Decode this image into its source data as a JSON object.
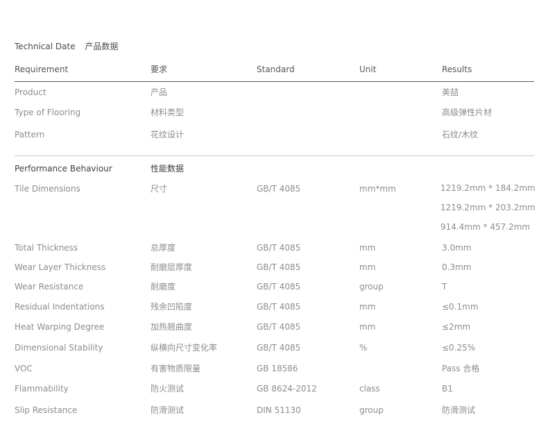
{
  "title": {
    "en": "Technical Date",
    "zh": "产品数据"
  },
  "header": {
    "requirement": "Requirement",
    "requirement_zh": "要求",
    "standard": "Standard",
    "unit": "Unit",
    "results": "Results"
  },
  "product_rows": [
    {
      "en": "Product",
      "zh": "产品",
      "result": "美喆"
    },
    {
      "en": "Type of Flooring",
      "zh": "材料类型",
      "result": "高级弹性片材"
    },
    {
      "en": "Pattern",
      "zh": "花纹设计",
      "result": "石纹/木纹"
    }
  ],
  "performance": {
    "section_en": "Performance Behaviour",
    "section_zh": "性能数据",
    "tile_dimensions": {
      "en": "Tile Dimensions",
      "zh": "尺寸",
      "standard": "GB/T 4085",
      "unit": "mm*mm",
      "results": [
        "1219.2mm * 184.2mm",
        "1219.2mm * 203.2mm",
        "914.4mm * 457.2mm"
      ]
    },
    "rows": [
      {
        "en": "Total Thickness",
        "zh": "总厚度",
        "standard": "GB/T 4085",
        "unit": "mm",
        "result": "3.0mm"
      },
      {
        "en": "Wear Layer Thickness",
        "zh": "耐磨层厚度",
        "standard": "GB/T 4085",
        "unit": "mm",
        "result": "0.3mm"
      },
      {
        "en": "Wear Resistance",
        "zh": "耐磨度",
        "standard": "GB/T 4085",
        "unit": "group",
        "result": "T"
      },
      {
        "en": "Residual Indentations",
        "zh": "残余凹陷度",
        "standard": "GB/T 4085",
        "unit": "mm",
        "result": "≤0.1mm"
      },
      {
        "en": "Heat Warping Degree",
        "zh": "加热翘曲度",
        "standard": "GB/T 4085",
        "unit": "mm",
        "result": "≤2mm"
      },
      {
        "en": "Dimensional Stability",
        "zh": "纵横向尺寸变化率",
        "standard": "GB/T 4085",
        "unit": "%",
        "result": "≤0.25%"
      },
      {
        "en": "VOC",
        "zh": "有害物质限量",
        "standard": "GB 18586",
        "unit": "",
        "result": "Pass 合格"
      },
      {
        "en": "Flammability",
        "zh": "防火测试",
        "standard": "GB 8624-2012",
        "unit": "class",
        "result": "B1"
      },
      {
        "en": "Slip Resistance",
        "zh": "防滑测试",
        "standard": "DIN 51130",
        "unit": "group",
        "result": "防滑测试"
      }
    ]
  }
}
